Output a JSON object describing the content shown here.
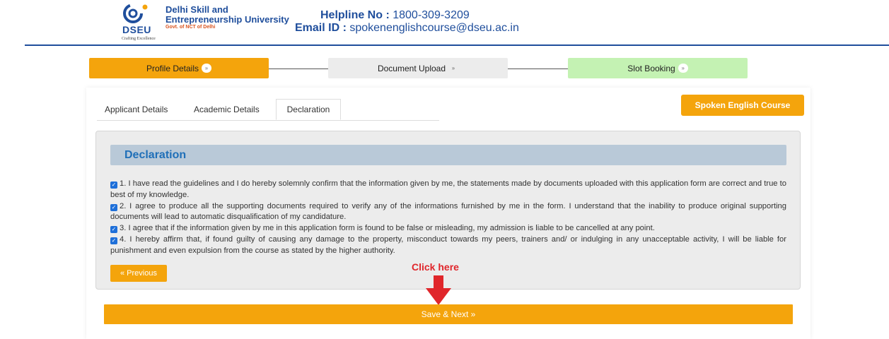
{
  "header": {
    "logo_abbr": "DSEU",
    "logo_tagline": "Crafting Excellence",
    "university_line1": "Delhi Skill and",
    "university_line2": "Entrepreneurship University",
    "university_sub": "Govt. of NCT of Delhi",
    "helpline_label": "Helpline No :",
    "helpline_value": "1800-309-3209",
    "email_label": "Email ID :",
    "email_value": "spokenenglishcourse@dseu.ac.in"
  },
  "steps": [
    {
      "label": "Profile Details",
      "arrow": "»",
      "color": "#f4a40c"
    },
    {
      "label": "Document Upload",
      "arrow": "»",
      "color": "#ececec"
    },
    {
      "label": "Slot Booking",
      "arrow": "»",
      "color": "#c4f2b3"
    }
  ],
  "tabs": [
    {
      "label": "Applicant Details"
    },
    {
      "label": "Academic Details"
    },
    {
      "label": "Declaration",
      "active": true
    }
  ],
  "course_button": "Spoken English Course",
  "declaration": {
    "title": "Declaration",
    "items": [
      {
        "checked": true,
        "text": "1. I have read the guidelines and I do hereby solemnly confirm that the information given by me, the statements made by documents uploaded with this application form are correct and true to best of my knowledge."
      },
      {
        "checked": true,
        "text": "2. I agree to produce all the supporting documents required to verify any of the informations furnished by me in the form. I understand that the inability to produce original supporting documents will lead to automatic disqualification of my candidature."
      },
      {
        "checked": true,
        "text": "3. I agree that if the information given by me in this application form is found to be false or misleading, my admission is liable to be cancelled at any point."
      },
      {
        "checked": true,
        "text": "4. I hereby affirm that, if found guilty of causing any damage to the property, misconduct towards my peers, trainers and/ or indulging in any unacceptable activity, I will be liable for punishment and even expulsion from the course as stated by the higher authority."
      }
    ]
  },
  "previous_button": "« Previous",
  "annotation": "Click here",
  "save_button": "Save & Next »",
  "colors": {
    "accent": "#f4a40c",
    "brand_blue": "#1f4e9c",
    "annotation_red": "#e0262b"
  }
}
